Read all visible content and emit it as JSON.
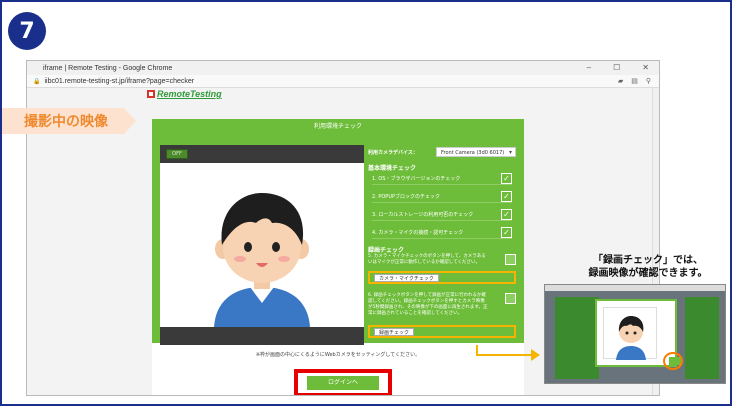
{
  "step_number": "7",
  "browser": {
    "title": "iframe | Remote Testing - Google Chrome",
    "url": "iibc01.remote-testing-st.jp/iframe?page=checker",
    "window_buttons": [
      "–",
      "☐",
      "✕"
    ]
  },
  "logo": {
    "text": "RemoteTesting"
  },
  "card": {
    "header": "利用環境チェック",
    "camera_badge": "OFF",
    "device_label": "利用カメラデバイス：",
    "device_value": "Front Camera (3d0 6017)",
    "basic_section": "基本環境チェック",
    "basic_items": [
      "1. OS・ブラウザバージョンのチェック",
      "2. POPUPブロックのチェック",
      "3. ローカルストレージの利用可否のチェック",
      "4. カメラ・マイクの接続・認可チェック"
    ],
    "record_section": "録画チェック",
    "record_item1": "5. カメラ・マイクチェックのボタンを押して、カメラあるいはマイクが正常に動作しているか確認してください。",
    "camera_mic_button": "カメラ・マイクチェック",
    "record_item2": "6. 録画チェックボタンを押して録画が正常に行われるか確認してください。録画チェックボタンを押すとカメラ映像が5秒間録画され、その映像が下の画面に再生されます。正常に録画されていることを確認してください。",
    "record_button": "録画チェック",
    "note": "※枠が画面の中心にくるようにWebカメラをセッティングしてください。",
    "login_button": "ログインへ"
  },
  "callout": "撮影中の映像",
  "caption": [
    "「録画チェック」では、",
    "録画映像が確認できます。"
  ],
  "colors": {
    "accent_green": "#6ebd3a",
    "frame_blue": "#1a2f8c",
    "highlight_red": "#e60000",
    "highlight_yellow": "#f5b400",
    "callout_orange": "#f08a30"
  }
}
